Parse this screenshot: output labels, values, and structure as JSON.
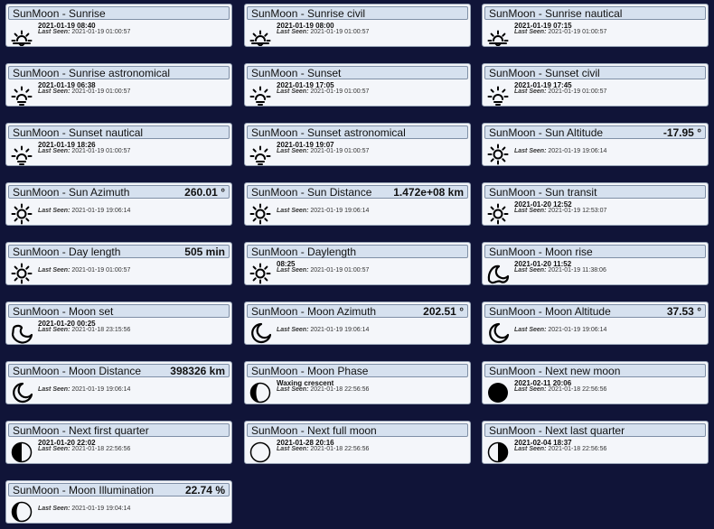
{
  "colors": {
    "background": "#101438",
    "tile": "#f4f6fa",
    "header": "#d6e1ef"
  },
  "last_seen_label": "Last Seen:",
  "tiles": [
    {
      "title": "SunMoon - Sunrise",
      "value": "",
      "state": "2021-01-19 08:40",
      "last_seen": "2021-01-19 01:00:57",
      "icon": "sunrise-icon"
    },
    {
      "title": "SunMoon - Sunrise civil",
      "value": "",
      "state": "2021-01-19 08:00",
      "last_seen": "2021-01-19 01:00:57",
      "icon": "sunrise-icon"
    },
    {
      "title": "SunMoon - Sunrise nautical",
      "value": "",
      "state": "2021-01-19 07:15",
      "last_seen": "2021-01-19 01:00:57",
      "icon": "sunrise-icon"
    },
    {
      "title": "SunMoon - Sunrise astronomical",
      "value": "",
      "state": "2021-01-19 06:38",
      "last_seen": "2021-01-19 01:00:57",
      "icon": "sunset-icon"
    },
    {
      "title": "SunMoon - Sunset",
      "value": "",
      "state": "2021-01-19 17:05",
      "last_seen": "2021-01-19 01:00:57",
      "icon": "sunset-icon"
    },
    {
      "title": "SunMoon - Sunset civil",
      "value": "",
      "state": "2021-01-19 17:45",
      "last_seen": "2021-01-19 01:00:57",
      "icon": "sunset-icon"
    },
    {
      "title": "SunMoon - Sunset nautical",
      "value": "",
      "state": "2021-01-19 18:26",
      "last_seen": "2021-01-19 01:00:57",
      "icon": "sunset-icon"
    },
    {
      "title": "SunMoon - Sunset astronomical",
      "value": "",
      "state": "2021-01-19 19:07",
      "last_seen": "2021-01-19 01:00:57",
      "icon": "sunset-icon"
    },
    {
      "title": "SunMoon - Sun Altitude",
      "value": "-17.95 °",
      "state": "",
      "last_seen": "2021-01-19 19:06:14",
      "icon": "sun-icon"
    },
    {
      "title": "SunMoon - Sun Azimuth",
      "value": "260.01 °",
      "state": "",
      "last_seen": "2021-01-19 19:06:14",
      "icon": "sun-icon"
    },
    {
      "title": "SunMoon - Sun Distance",
      "value": "1.472e+08 km",
      "state": "",
      "last_seen": "2021-01-19 19:06:14",
      "icon": "sun-icon"
    },
    {
      "title": "SunMoon - Sun transit",
      "value": "",
      "state": "2021-01-20 12:52",
      "last_seen": "2021-01-19 12:53:07",
      "icon": "sun-icon"
    },
    {
      "title": "SunMoon - Day length",
      "value": "505 min",
      "state": "",
      "last_seen": "2021-01-19 01:00:57",
      "icon": "sun-icon"
    },
    {
      "title": "SunMoon - Daylength",
      "value": "",
      "state": "08:25",
      "last_seen": "2021-01-19 01:00:57",
      "icon": "sun-icon"
    },
    {
      "title": "SunMoon - Moon rise",
      "value": "",
      "state": "2021-01-20 11:52",
      "last_seen": "2021-01-19 11:38:06",
      "icon": "moonrise-icon"
    },
    {
      "title": "SunMoon - Moon set",
      "value": "",
      "state": "2021-01-20 00:25",
      "last_seen": "2021-01-18 23:15:56",
      "icon": "moonset-icon"
    },
    {
      "title": "SunMoon - Moon Azimuth",
      "value": "202.51 °",
      "state": "",
      "last_seen": "2021-01-19 19:06:14",
      "icon": "moon-icon"
    },
    {
      "title": "SunMoon - Moon Altitude",
      "value": "37.53 °",
      "state": "",
      "last_seen": "2021-01-19 19:06:14",
      "icon": "moon-icon"
    },
    {
      "title": "SunMoon - Moon Distance",
      "value": "398326 km",
      "state": "",
      "last_seen": "2021-01-19 19:06:14",
      "icon": "moon-icon"
    },
    {
      "title": "SunMoon - Moon Phase",
      "value": "",
      "state": "Waxing crescent",
      "last_seen": "2021-01-18 22:56:56",
      "icon": "waxing-crescent-icon"
    },
    {
      "title": "SunMoon - Next new moon",
      "value": "",
      "state": "2021-02-11 20:06",
      "last_seen": "2021-01-18 22:56:56",
      "icon": "new-moon-icon"
    },
    {
      "title": "SunMoon - Next first quarter",
      "value": "",
      "state": "2021-01-20 22:02",
      "last_seen": "2021-01-18 22:56:56",
      "icon": "first-quarter-icon"
    },
    {
      "title": "SunMoon - Next full moon",
      "value": "",
      "state": "2021-01-28 20:16",
      "last_seen": "2021-01-18 22:56:56",
      "icon": "full-moon-icon"
    },
    {
      "title": "SunMoon - Next last quarter",
      "value": "",
      "state": "2021-02-04 18:37",
      "last_seen": "2021-01-18 22:56:56",
      "icon": "last-quarter-icon"
    },
    {
      "title": "SunMoon - Moon Illumination",
      "value": "22.74 %",
      "state": "",
      "last_seen": "2021-01-19 19:04:14",
      "icon": "illumination-moon-icon"
    }
  ]
}
